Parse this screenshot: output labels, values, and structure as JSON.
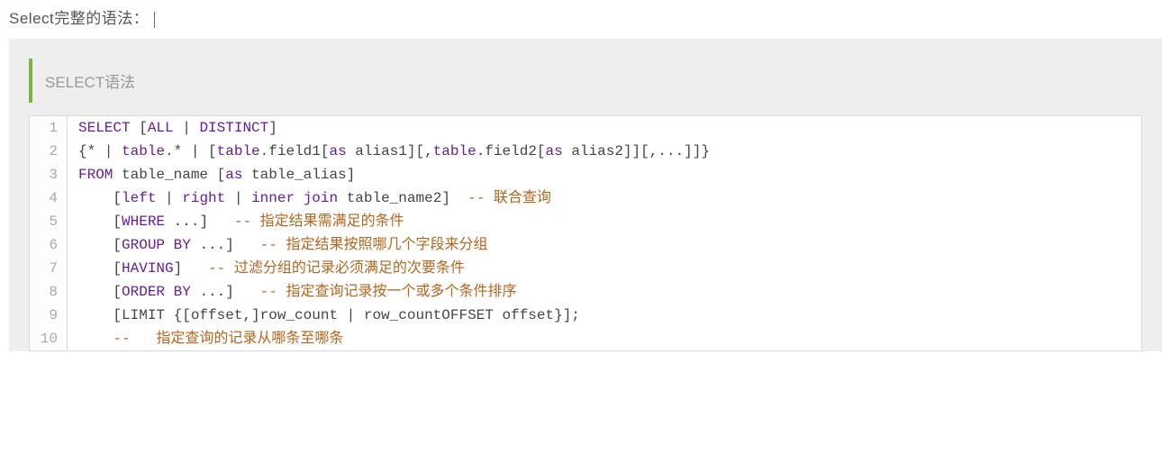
{
  "heading": "Select完整的语法：",
  "quote_label": "SELECT语法",
  "code_lines": {
    "l1_select": "SELECT",
    "l1_all": "ALL",
    "l1_pipe": " | ",
    "l1_distinct": "DISTINCT",
    "l2_a": "{* | ",
    "l2_b": "table",
    "l2_c": ".* | [",
    "l2_d": "table",
    "l2_e": ".field1[",
    "l2_f": "as",
    "l2_g": " alias1][,",
    "l2_h": "table",
    "l2_i": ".field2[",
    "l2_j": "as",
    "l2_k": " alias2]][,...]]}",
    "l3_from": "FROM",
    "l3_rest": " table_name [",
    "l3_as": "as",
    "l3_rest2": " table_alias]",
    "l4_a": "    [",
    "l4_left": "left",
    "l4_pipe1": " | ",
    "l4_right": "right",
    "l4_pipe2": " | ",
    "l4_inner": "inner",
    "l4_sp": " ",
    "l4_join": "join",
    "l4_rest": " table_name2]  ",
    "l4_cmt": "-- 联合查询",
    "l5_a": "    [",
    "l5_where": "WHERE",
    "l5_rest": " ...]   ",
    "l5_cmt": "-- 指定结果需满足的条件",
    "l6_a": "    [",
    "l6_group": "GROUP",
    "l6_sp": " ",
    "l6_by": "BY",
    "l6_rest": " ...]   ",
    "l6_cmt": "-- 指定结果按照哪几个字段来分组",
    "l7_a": "    [",
    "l7_having": "HAVING",
    "l7_rest": "]   ",
    "l7_cmt": "-- 过滤分组的记录必须满足的次要条件",
    "l8_a": "    [",
    "l8_order": "ORDER",
    "l8_sp": " ",
    "l8_by": "BY",
    "l8_rest": " ...]   ",
    "l8_cmt": "-- 指定查询记录按一个或多个条件排序",
    "l9_a": "    [LIMIT {[offset,]row_count | row_countOFFSET offset}];",
    "l10_cmt": "    --   指定查询的记录从哪条至哪条"
  },
  "line_numbers": [
    "1",
    "2",
    "3",
    "4",
    "5",
    "6",
    "7",
    "8",
    "9",
    "10"
  ]
}
